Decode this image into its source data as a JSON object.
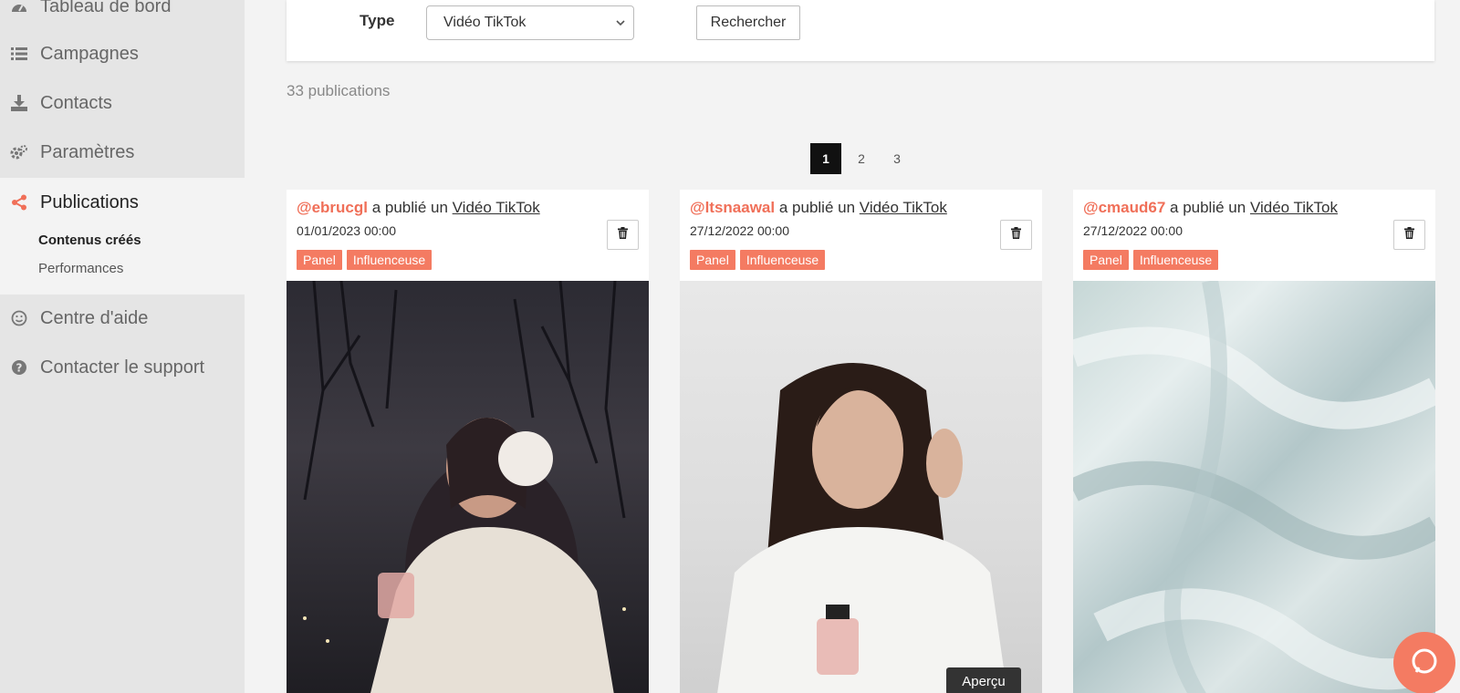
{
  "sidebar": {
    "items": [
      {
        "label": "Tableau de bord",
        "icon": "dashboard-icon"
      },
      {
        "label": "Campagnes",
        "icon": "list-icon"
      },
      {
        "label": "Contacts",
        "icon": "download-icon"
      },
      {
        "label": "Paramètres",
        "icon": "gears-icon"
      },
      {
        "label": "Publications",
        "icon": "share-icon"
      },
      {
        "label": "Centre d'aide",
        "icon": "smile-icon"
      },
      {
        "label": "Contacter le support",
        "icon": "question-circle-icon"
      }
    ],
    "subitems": [
      {
        "label": "Contenus créés"
      },
      {
        "label": "Performances"
      }
    ],
    "accent_color": "#f06f58"
  },
  "filter": {
    "type_label": "Type",
    "type_value": "Vidéo TikTok",
    "search_label": "Rechercher"
  },
  "results": {
    "count_text": "33 publications"
  },
  "pagination": {
    "pages": [
      "1",
      "2",
      "3"
    ],
    "current": "1"
  },
  "cards": [
    {
      "handle": "@ebrucgl",
      "action": "a publié un",
      "type": "Vidéo TikTok",
      "date": "01/01/2023 00:00",
      "tags": [
        "Panel",
        "Influenceuse"
      ]
    },
    {
      "handle": "@ltsnaawal",
      "action": "a publié un",
      "type": "Vidéo TikTok",
      "date": "27/12/2022 00:00",
      "tags": [
        "Panel",
        "Influenceuse"
      ]
    },
    {
      "handle": "@cmaud67",
      "action": "a publié un",
      "type": "Vidéo TikTok",
      "date": "27/12/2022 00:00",
      "tags": [
        "Panel",
        "Influenceuse"
      ]
    }
  ],
  "preview_tooltip": "Aperçu",
  "tag_color": "#f47b62"
}
